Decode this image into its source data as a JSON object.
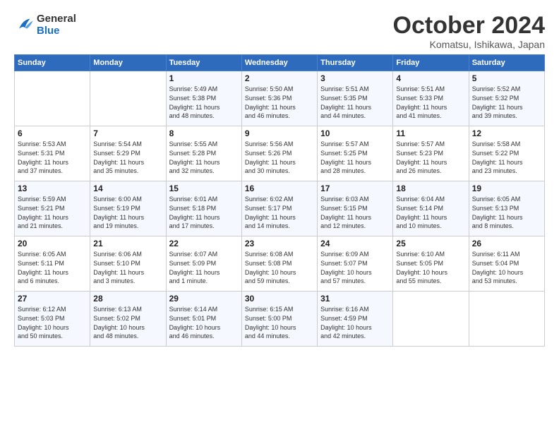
{
  "logo": {
    "line1": "General",
    "line2": "Blue"
  },
  "title": "October 2024",
  "subtitle": "Komatsu, Ishikawa, Japan",
  "days_header": [
    "Sunday",
    "Monday",
    "Tuesday",
    "Wednesday",
    "Thursday",
    "Friday",
    "Saturday"
  ],
  "weeks": [
    [
      {
        "num": "",
        "content": ""
      },
      {
        "num": "",
        "content": ""
      },
      {
        "num": "1",
        "content": "Sunrise: 5:49 AM\nSunset: 5:38 PM\nDaylight: 11 hours\nand 48 minutes."
      },
      {
        "num": "2",
        "content": "Sunrise: 5:50 AM\nSunset: 5:36 PM\nDaylight: 11 hours\nand 46 minutes."
      },
      {
        "num": "3",
        "content": "Sunrise: 5:51 AM\nSunset: 5:35 PM\nDaylight: 11 hours\nand 44 minutes."
      },
      {
        "num": "4",
        "content": "Sunrise: 5:51 AM\nSunset: 5:33 PM\nDaylight: 11 hours\nand 41 minutes."
      },
      {
        "num": "5",
        "content": "Sunrise: 5:52 AM\nSunset: 5:32 PM\nDaylight: 11 hours\nand 39 minutes."
      }
    ],
    [
      {
        "num": "6",
        "content": "Sunrise: 5:53 AM\nSunset: 5:31 PM\nDaylight: 11 hours\nand 37 minutes."
      },
      {
        "num": "7",
        "content": "Sunrise: 5:54 AM\nSunset: 5:29 PM\nDaylight: 11 hours\nand 35 minutes."
      },
      {
        "num": "8",
        "content": "Sunrise: 5:55 AM\nSunset: 5:28 PM\nDaylight: 11 hours\nand 32 minutes."
      },
      {
        "num": "9",
        "content": "Sunrise: 5:56 AM\nSunset: 5:26 PM\nDaylight: 11 hours\nand 30 minutes."
      },
      {
        "num": "10",
        "content": "Sunrise: 5:57 AM\nSunset: 5:25 PM\nDaylight: 11 hours\nand 28 minutes."
      },
      {
        "num": "11",
        "content": "Sunrise: 5:57 AM\nSunset: 5:23 PM\nDaylight: 11 hours\nand 26 minutes."
      },
      {
        "num": "12",
        "content": "Sunrise: 5:58 AM\nSunset: 5:22 PM\nDaylight: 11 hours\nand 23 minutes."
      }
    ],
    [
      {
        "num": "13",
        "content": "Sunrise: 5:59 AM\nSunset: 5:21 PM\nDaylight: 11 hours\nand 21 minutes."
      },
      {
        "num": "14",
        "content": "Sunrise: 6:00 AM\nSunset: 5:19 PM\nDaylight: 11 hours\nand 19 minutes."
      },
      {
        "num": "15",
        "content": "Sunrise: 6:01 AM\nSunset: 5:18 PM\nDaylight: 11 hours\nand 17 minutes."
      },
      {
        "num": "16",
        "content": "Sunrise: 6:02 AM\nSunset: 5:17 PM\nDaylight: 11 hours\nand 14 minutes."
      },
      {
        "num": "17",
        "content": "Sunrise: 6:03 AM\nSunset: 5:15 PM\nDaylight: 11 hours\nand 12 minutes."
      },
      {
        "num": "18",
        "content": "Sunrise: 6:04 AM\nSunset: 5:14 PM\nDaylight: 11 hours\nand 10 minutes."
      },
      {
        "num": "19",
        "content": "Sunrise: 6:05 AM\nSunset: 5:13 PM\nDaylight: 11 hours\nand 8 minutes."
      }
    ],
    [
      {
        "num": "20",
        "content": "Sunrise: 6:05 AM\nSunset: 5:11 PM\nDaylight: 11 hours\nand 6 minutes."
      },
      {
        "num": "21",
        "content": "Sunrise: 6:06 AM\nSunset: 5:10 PM\nDaylight: 11 hours\nand 3 minutes."
      },
      {
        "num": "22",
        "content": "Sunrise: 6:07 AM\nSunset: 5:09 PM\nDaylight: 11 hours\nand 1 minute."
      },
      {
        "num": "23",
        "content": "Sunrise: 6:08 AM\nSunset: 5:08 PM\nDaylight: 10 hours\nand 59 minutes."
      },
      {
        "num": "24",
        "content": "Sunrise: 6:09 AM\nSunset: 5:07 PM\nDaylight: 10 hours\nand 57 minutes."
      },
      {
        "num": "25",
        "content": "Sunrise: 6:10 AM\nSunset: 5:05 PM\nDaylight: 10 hours\nand 55 minutes."
      },
      {
        "num": "26",
        "content": "Sunrise: 6:11 AM\nSunset: 5:04 PM\nDaylight: 10 hours\nand 53 minutes."
      }
    ],
    [
      {
        "num": "27",
        "content": "Sunrise: 6:12 AM\nSunset: 5:03 PM\nDaylight: 10 hours\nand 50 minutes."
      },
      {
        "num": "28",
        "content": "Sunrise: 6:13 AM\nSunset: 5:02 PM\nDaylight: 10 hours\nand 48 minutes."
      },
      {
        "num": "29",
        "content": "Sunrise: 6:14 AM\nSunset: 5:01 PM\nDaylight: 10 hours\nand 46 minutes."
      },
      {
        "num": "30",
        "content": "Sunrise: 6:15 AM\nSunset: 5:00 PM\nDaylight: 10 hours\nand 44 minutes."
      },
      {
        "num": "31",
        "content": "Sunrise: 6:16 AM\nSunset: 4:59 PM\nDaylight: 10 hours\nand 42 minutes."
      },
      {
        "num": "",
        "content": ""
      },
      {
        "num": "",
        "content": ""
      }
    ]
  ]
}
